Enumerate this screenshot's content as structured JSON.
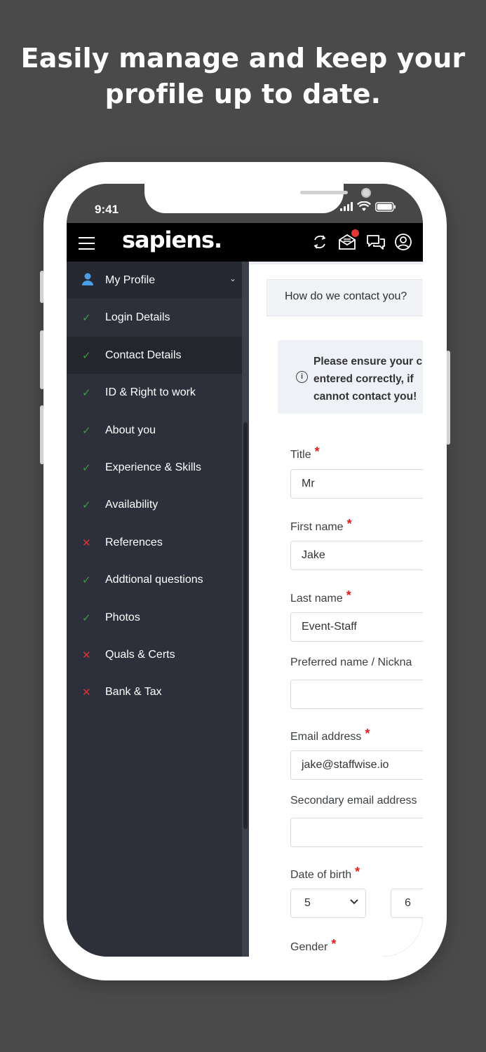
{
  "headline": {
    "line1": "Easily manage and keep your",
    "line2": "profile up to date."
  },
  "status_bar": {
    "time": "9:41"
  },
  "app_bar": {
    "logo": "sapiens."
  },
  "sidebar": {
    "header": {
      "label": "My Profile",
      "icon": "user-icon"
    },
    "items": [
      {
        "label": "Login Details",
        "status": "complete",
        "mark": "✓"
      },
      {
        "label": "Contact Details",
        "status": "complete",
        "mark": "✓"
      },
      {
        "label": "ID & Right to work",
        "status": "complete",
        "mark": "✓"
      },
      {
        "label": "About you",
        "status": "complete",
        "mark": "✓"
      },
      {
        "label": "Experience & Skills",
        "status": "complete",
        "mark": "✓"
      },
      {
        "label": "Availability",
        "status": "complete",
        "mark": "✓"
      },
      {
        "label": "References",
        "status": "incomplete",
        "mark": "✕"
      },
      {
        "label": "Addtional questions",
        "status": "complete",
        "mark": "✓"
      },
      {
        "label": "Photos",
        "status": "complete",
        "mark": "✓"
      },
      {
        "label": "Quals & Certs",
        "status": "incomplete",
        "mark": "✕"
      },
      {
        "label": "Bank & Tax",
        "status": "incomplete",
        "mark": "✕"
      }
    ]
  },
  "content": {
    "section_title": "How do we contact you?",
    "alert": {
      "line1": "Please ensure your c",
      "line2": "entered correctly, if",
      "line3": "cannot contact you!"
    },
    "fields": {
      "title": {
        "label": "Title",
        "value": "Mr",
        "required": "*"
      },
      "first_name": {
        "label": "First name",
        "value": "Jake",
        "required": "*"
      },
      "last_name": {
        "label": "Last name",
        "value": "Event-Staff",
        "required": "*"
      },
      "preferred_name": {
        "label": "Preferred name / Nickna",
        "value": ""
      },
      "email": {
        "label": "Email address",
        "value": "jake@staffwise.io",
        "required": "*"
      },
      "secondary_email": {
        "label": "Secondary email address",
        "value": ""
      },
      "dob": {
        "label": "Date of birth",
        "day": "5",
        "month": "6",
        "required": "*"
      },
      "gender": {
        "label": "Gender",
        "required": "*"
      }
    }
  },
  "colors": {
    "complete": "#3f9a45",
    "incomplete": "#d73535",
    "required": "#e02020",
    "sidebar_bg": "#2d303a"
  }
}
